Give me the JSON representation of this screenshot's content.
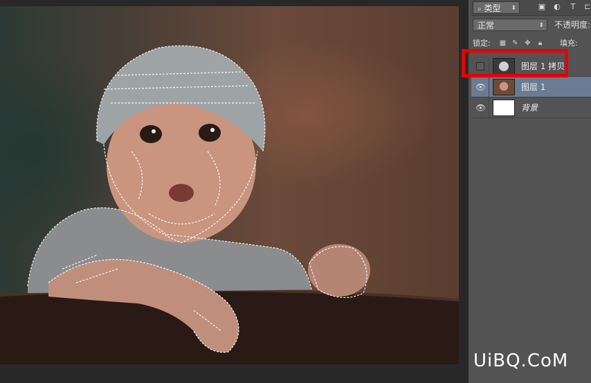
{
  "layers_panel": {
    "filter_label": "类型",
    "blend_mode": "正常",
    "opacity_label": "不透明度:",
    "lock_label": "锁定:",
    "fill_label": "填充:",
    "layers": [
      {
        "name": "图层 1 拷贝",
        "visible": false,
        "selected": false
      },
      {
        "name": "图层 1",
        "visible": true,
        "selected": true
      },
      {
        "name": "背景",
        "visible": true,
        "selected": false
      }
    ]
  },
  "watermark": "UiBQ.CoM",
  "colors": {
    "highlight": "#e90000",
    "selected_layer": "#6b7b94",
    "panel": "#535353"
  }
}
